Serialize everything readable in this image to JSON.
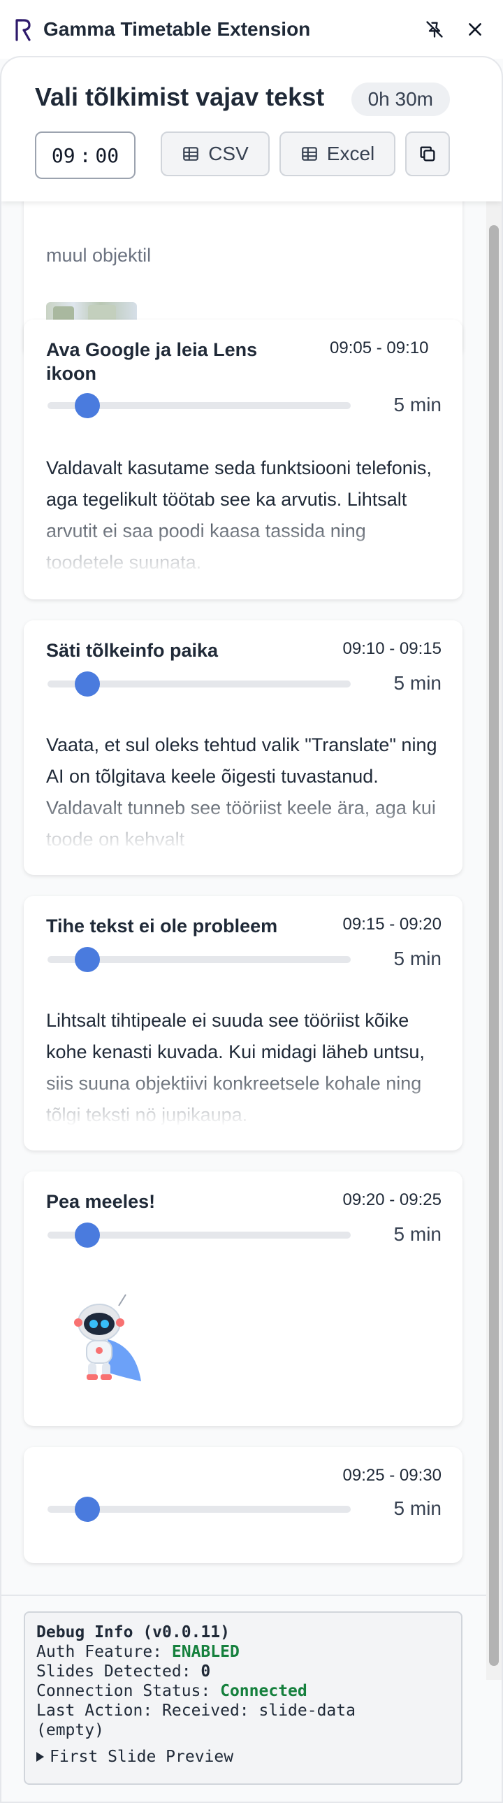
{
  "app": {
    "title": "Gamma Timetable Extension"
  },
  "header": {
    "title": "Vali tõlkimist vajav tekst",
    "duration": "0h 30m",
    "start_hour": "09",
    "separator": ":",
    "start_minute": "00",
    "csv_label": "CSV",
    "excel_label": "Excel"
  },
  "cards": [
    {
      "partial_text": "muul objektil"
    },
    {
      "title": "Ava Google ja leia Lens ikoon",
      "time": "09:05 - 09:10",
      "minutes": "5 min",
      "slider_fraction": 0.1,
      "body": "Valdavalt kasutame seda funktsiooni telefonis, aga tegelikult töötab see ka arvutis. Lihtsalt arvutit ei saa poodi kaasa tassida ning toodetele suunata."
    },
    {
      "title": "Säti tõlkeinfo paika",
      "time": "09:10 - 09:15",
      "minutes": "5 min",
      "slider_fraction": 0.1,
      "body": "Vaata, et sul oleks tehtud valik \"Translate\" ning AI on tõlgitava keele õigesti tuvastanud. Valdavalt tunneb see tööriist keele ära, aga kui toode on kehvalt"
    },
    {
      "title": "Tihe tekst ei ole probleem",
      "time": "09:15 - 09:20",
      "minutes": "5 min",
      "slider_fraction": 0.1,
      "body": "Lihtsalt tihtipeale ei suuda see tööriist kõike kohe kenasti kuvada. Kui midagi läheb untsu, siis suuna objektiivi konkreetsele kohale ning tõlgi teksti nö jupikaupa."
    },
    {
      "title": "Pea meeles!",
      "time": "09:20 - 09:25",
      "minutes": "5 min",
      "slider_fraction": 0.1
    },
    {
      "title": "",
      "time": "09:25 - 09:30",
      "minutes": "5 min",
      "slider_fraction": 0.1
    }
  ],
  "debug": {
    "title": "Debug Info (v0.0.11)",
    "auth_label": "Auth Feature:",
    "auth_value": "ENABLED",
    "slides_label": "Slides Detected:",
    "slides_value": "0",
    "connection_label": "Connection Status:",
    "connection_value": "Connected",
    "last_action_label": "Last Action:",
    "last_action_value": "Received: slide-data",
    "last_action_extra": "(empty)",
    "preview_label": "First Slide Preview"
  },
  "colors": {
    "accent": "#4a7bde",
    "success": "#15803d",
    "brand": "#2e1a6b"
  }
}
